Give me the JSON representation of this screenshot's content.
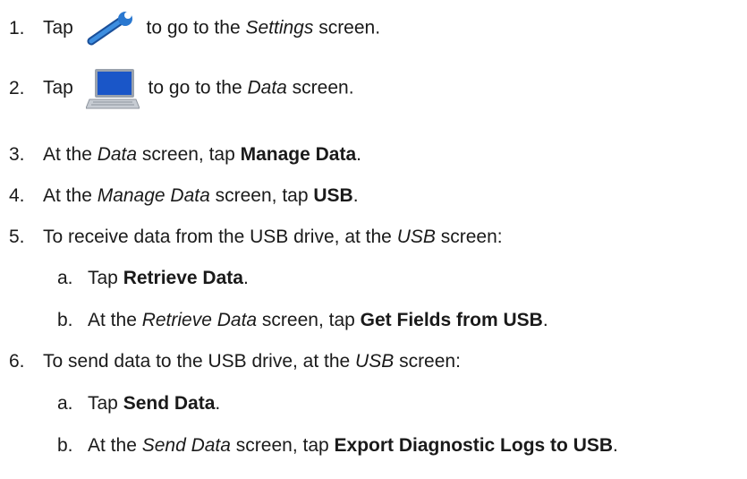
{
  "steps": [
    {
      "number": "1.",
      "pre": "Tap",
      "icon": "wrench-icon",
      "post_a": " to go to the ",
      "em": "Settings",
      "post_b": " screen."
    },
    {
      "number": "2.",
      "pre": "Tap",
      "icon": "laptop-icon",
      "post_a": " to go to the ",
      "em": "Data",
      "post_b": " screen."
    },
    {
      "number": "3.",
      "a": "At the ",
      "em": "Data",
      "b": " screen, tap ",
      "strong": "Manage Data",
      "c": "."
    },
    {
      "number": "4.",
      "a": "At the ",
      "em": "Manage Data",
      "b": " screen, tap ",
      "strong": "USB",
      "c": "."
    },
    {
      "number": "5.",
      "a": "To receive data from the USB drive, at the ",
      "em": "USB",
      "b": " screen:"
    },
    {
      "number": "6.",
      "a": "To send data to the USB drive, at the ",
      "em": "USB",
      "b": " screen:"
    }
  ],
  "substeps5": [
    {
      "letter": "a.",
      "a": "Tap ",
      "strong": "Retrieve Data",
      "c": "."
    },
    {
      "letter": "b.",
      "a": "At the ",
      "em": "Retrieve Data",
      "b": " screen, tap ",
      "strong": "Get Fields from USB",
      "c": "."
    }
  ],
  "substeps6": [
    {
      "letter": "a.",
      "a": "Tap ",
      "strong": "Send Data",
      "c": "."
    },
    {
      "letter": "b.",
      "a": "At the ",
      "em": "Send Data",
      "b": " screen, tap ",
      "strong": "Export Diagnostic Logs to USB",
      "c": "."
    }
  ],
  "colors": {
    "wrench_blue": "#1f6fc4",
    "laptop_screen": "#1a56c8",
    "text": "#1a1a1a"
  }
}
